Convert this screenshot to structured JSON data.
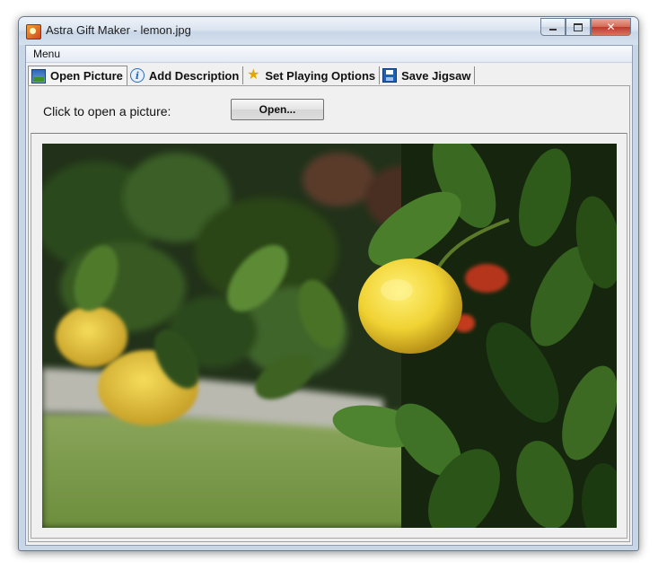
{
  "window": {
    "title": "Astra Gift Maker - lemon.jpg",
    "close_glyph": "✕"
  },
  "menu": {
    "items": [
      {
        "label": "Menu"
      }
    ]
  },
  "tabs": [
    {
      "label": "Open Picture",
      "icon": "picture-icon",
      "active": true
    },
    {
      "label": "Add Description",
      "icon": "info-icon",
      "active": false
    },
    {
      "label": "Set Playing Options",
      "icon": "star-icon",
      "active": false
    },
    {
      "label": "Save Jigsaw",
      "icon": "floppy-disk-icon",
      "active": false
    }
  ],
  "open_panel": {
    "prompt": "Click to open a picture:",
    "button_label": "Open..."
  },
  "colors": {
    "lemon": "#f2d63a",
    "leaf_dark": "#1d3512",
    "leaf_light": "#5f8a36",
    "grass": "#7a9a4a"
  }
}
